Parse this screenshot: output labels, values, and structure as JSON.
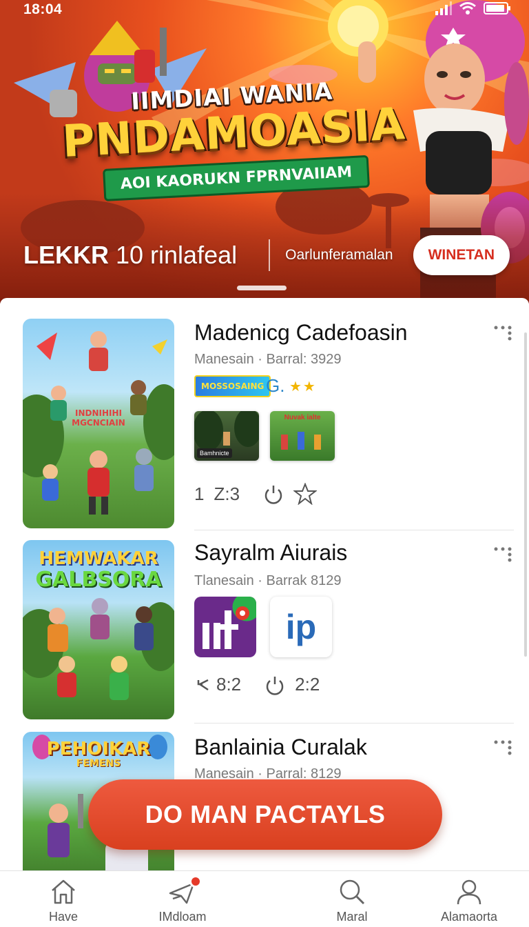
{
  "status_bar": {
    "time": "18:04"
  },
  "hero": {
    "supertitle": "IIMDIAI WANIA",
    "title": "PNDAMOASIA",
    "ribbon": "AOI KAORUKN FPRNVAIIAM",
    "stat_bold": "LEKKR",
    "stat_rest": " 10 rinlafeal",
    "link": "Oarlunferamalan",
    "button": "WINETAN"
  },
  "items": [
    {
      "title": "Madenicg Cadefoasin",
      "subtitle": "Manesain · Barral: 3929",
      "thumb_label": "INDNIHIHI\nMGCNCIAIN",
      "badge": "MOSSOSAING",
      "rating_icon": "G.",
      "stars": "★★",
      "shot1_label": "Bamhnicte",
      "shot2_label": "Nuvak ialte",
      "stat_a": "1",
      "stat_b": "Z:3"
    },
    {
      "title": "Sayralm Aiurais",
      "subtitle": "Tlanesain · Barrak 8129",
      "thumb_label_1": "HEMWAKAR",
      "thumb_label_2": "GALBSORA",
      "tile2_text": "ip",
      "stat_a": "8:2",
      "stat_b": "2:2"
    },
    {
      "title": "Banlainia Curalak",
      "subtitle": "Manesain · Parral: 8129",
      "thumb_label_1": "PEHOIKAR",
      "thumb_label_2": "FEMENS"
    }
  ],
  "cta": {
    "label": "DO MAN PACTAYLS"
  },
  "nav": [
    {
      "label": "Have",
      "icon": "home-icon"
    },
    {
      "label": "IMdloam",
      "icon": "send-icon"
    },
    {
      "label": "Maral",
      "icon": "search-icon"
    },
    {
      "label": "Alamaorta",
      "icon": "profile-icon"
    }
  ],
  "colors": {
    "accent": "#e14a2c",
    "hero_sky": "#ff7a2a",
    "title_yellow": "#ffd23a",
    "ribbon_green": "#1f9a4a"
  }
}
